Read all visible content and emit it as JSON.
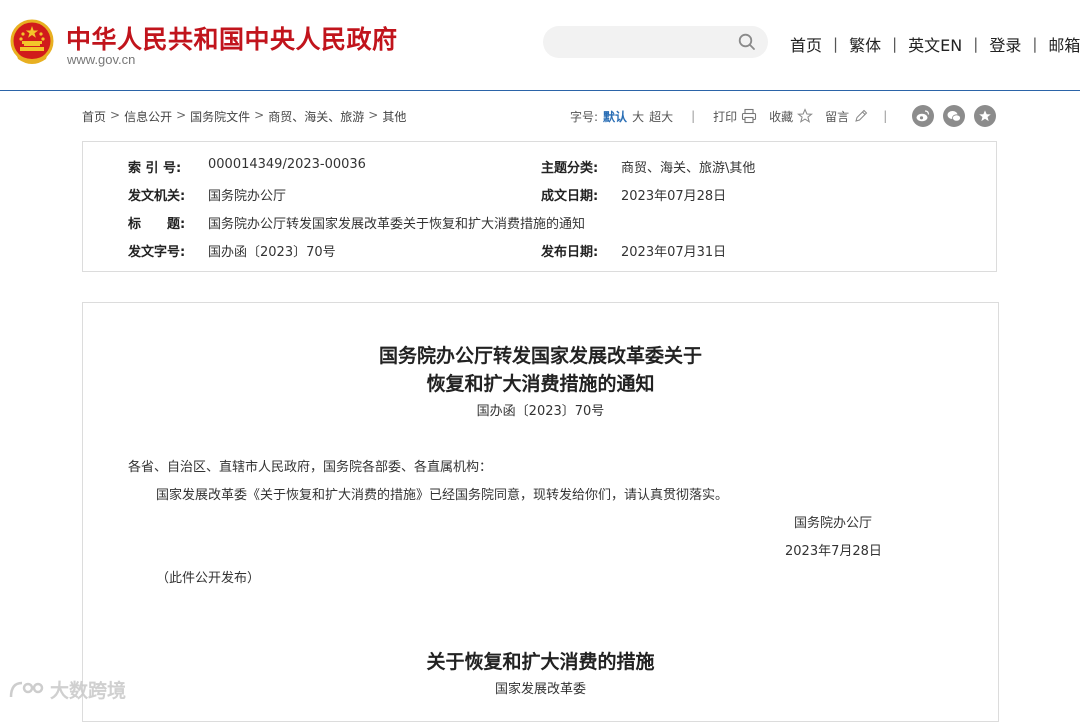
{
  "header": {
    "site_title": "中华人民共和国中央人民政府",
    "site_domain": "www.gov.cn",
    "search": {
      "placeholder": "",
      "icon": "search-icon"
    },
    "nav": [
      "首页",
      "繁体",
      "英文EN",
      "登录",
      "邮箱"
    ],
    "nav_separator": "|",
    "accent_color": "#c1141c",
    "rule_color": "#2b64a8"
  },
  "breadcrumb": {
    "items": [
      "首页",
      "信息公开",
      "国务院文件",
      "商贸、海关、旅游",
      "其他"
    ],
    "separator": ">"
  },
  "tools": {
    "font_size_label": "字号:",
    "font_sizes": [
      "默认",
      "大",
      "超大"
    ],
    "active_font_size": "默认",
    "print_label": "打印",
    "favorite_label": "收藏",
    "comment_label": "留言",
    "separator": "|",
    "share_icons": [
      "weibo-icon",
      "wechat-icon",
      "star-icon"
    ]
  },
  "meta": {
    "rows": [
      {
        "left_label": "索 引 号:",
        "left_value": "000014349/2023-00036",
        "right_label": "主题分类:",
        "right_value": "商贸、海关、旅游\\其他"
      },
      {
        "left_label": "发文机关:",
        "left_value": "国务院办公厅",
        "right_label": "成文日期:",
        "right_value": "2023年07月28日"
      },
      {
        "left_label": "标　　题:",
        "left_value": "国务院办公厅转发国家发展改革委关于恢复和扩大消费措施的通知",
        "right_label": "",
        "right_value": ""
      },
      {
        "left_label": "发文字号:",
        "left_value": "国办函〔2023〕70号",
        "right_label": "发布日期:",
        "right_value": "2023年07月31日"
      }
    ]
  },
  "document": {
    "title_line1": "国务院办公厅转发国家发展改革委关于",
    "title_line2": "恢复和扩大消费措施的通知",
    "doc_number": "国办函〔2023〕70号",
    "salutation": "各省、自治区、直辖市人民政府，国务院各部委、各直属机构：",
    "body": "国家发展改革委《关于恢复和扩大消费的措施》已经国务院同意，现转发给你们，请认真贯彻落实。",
    "signature": "国务院办公厅",
    "date": "2023年7月28日",
    "note": "（此件公开发布）",
    "subtitle": "关于恢复和扩大消费的措施",
    "subtitle_org": "国家发展改革委"
  },
  "watermark": {
    "text": "大数跨境"
  }
}
